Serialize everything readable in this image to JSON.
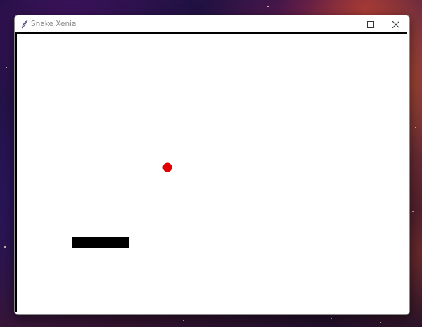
{
  "window": {
    "title": "Snake Xenia",
    "icon": "feather-icon",
    "controls": {
      "minimize_icon": "minimize-icon",
      "maximize_icon": "maximize-icon",
      "close_icon": "close-icon"
    }
  },
  "game": {
    "board_color": "#ffffff",
    "snake_color": "#000000",
    "food_color": "#e00000",
    "snake_segments": 5,
    "snake_direction": "right"
  }
}
